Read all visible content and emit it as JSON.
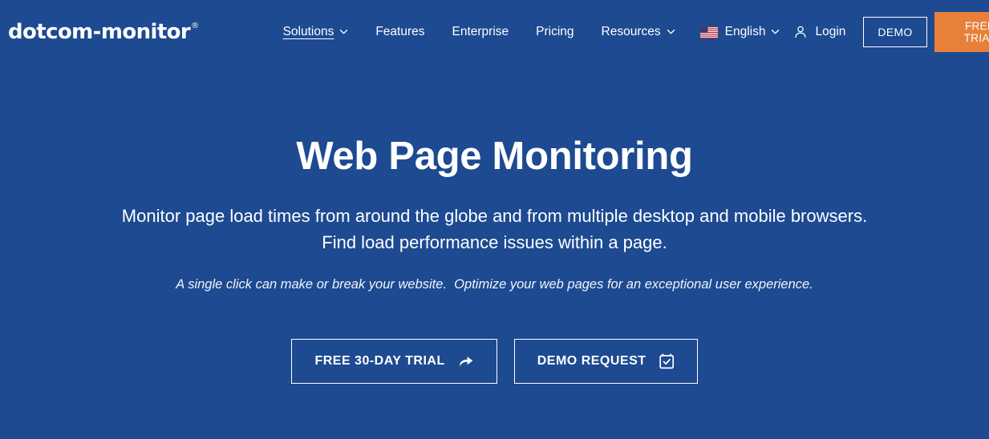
{
  "brand": {
    "logo_text": "dotcom-monitor",
    "logo_mark": "®",
    "accent_color": "#e8803a",
    "background_color": "#1d4a91"
  },
  "header": {
    "nav": [
      {
        "label": "Solutions",
        "has_caret": true,
        "active": true
      },
      {
        "label": "Features",
        "has_caret": false,
        "active": false
      },
      {
        "label": "Enterprise",
        "has_caret": false,
        "active": false
      },
      {
        "label": "Pricing",
        "has_caret": false,
        "active": false
      },
      {
        "label": "Resources",
        "has_caret": true,
        "active": false
      }
    ],
    "language": {
      "label": "English",
      "flag_icon": "us-flag-icon",
      "caret_icon": "chevron-down-icon"
    },
    "login": {
      "label": "Login",
      "icon": "user-icon"
    },
    "demo_button": "DEMO",
    "trial_button": "FREE\nTRIAL"
  },
  "hero": {
    "title": "Web Page Monitoring",
    "subtitle_line1": "Monitor page load times from around the globe and from multiple desktop and mobile browsers.",
    "subtitle_line2": "Find load performance issues within a page.",
    "tagline": "A single click can make or break your website.  Optimize your web pages for an exceptional user experience.",
    "cta_primary": "FREE 30-DAY TRIAL",
    "cta_primary_icon": "forward-arrow-icon",
    "cta_secondary": "DEMO REQUEST",
    "cta_secondary_icon": "calendar-check-icon"
  }
}
